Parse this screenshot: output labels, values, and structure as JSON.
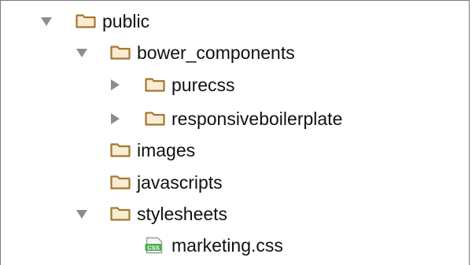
{
  "tree": {
    "items": [
      {
        "label": "public",
        "type": "folder",
        "state": "expanded"
      },
      {
        "label": "bower_components",
        "type": "folder",
        "state": "expanded"
      },
      {
        "label": "purecss",
        "type": "folder",
        "state": "collapsed"
      },
      {
        "label": "responsiveboilerplate",
        "type": "folder",
        "state": "collapsed"
      },
      {
        "label": "images",
        "type": "folder",
        "state": "leaf"
      },
      {
        "label": "javascripts",
        "type": "folder",
        "state": "leaf"
      },
      {
        "label": "stylesheets",
        "type": "folder",
        "state": "expanded"
      },
      {
        "label": "marketing.css",
        "type": "css-file",
        "state": "leaf"
      }
    ],
    "file_badge": "CSS"
  },
  "colors": {
    "folder_fill": "#f8ecd2",
    "folder_stroke": "#a57632",
    "arrow": "#8c8c8c",
    "css_badge": "#4caf50"
  },
  "icons": {
    "expand_arrow": "disclosure-down-icon",
    "collapse_arrow": "disclosure-right-icon",
    "folder": "folder-icon",
    "css_file": "css-file-icon"
  }
}
